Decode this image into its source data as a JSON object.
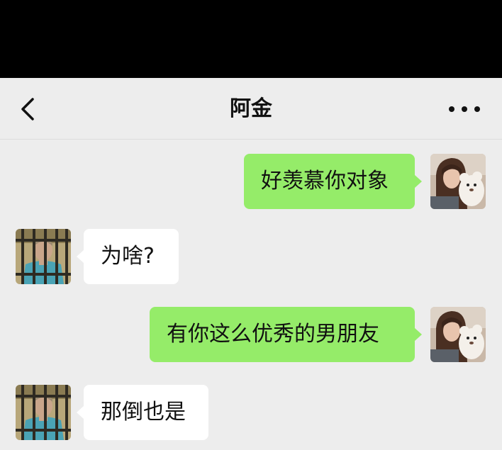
{
  "header": {
    "title": "阿金",
    "back_icon": "chevron-left-icon",
    "more_icon": "more-dots-icon"
  },
  "messages": [
    {
      "side": "out",
      "text": "好羡慕你对象",
      "avatar": "girl-with-teddy-bear"
    },
    {
      "side": "in",
      "text": "为啥?",
      "avatar": "man-behind-bars"
    },
    {
      "side": "out",
      "text": "有你这么优秀的男朋友",
      "avatar": "girl-with-teddy-bear"
    },
    {
      "side": "in",
      "text": "那倒也是",
      "avatar": "man-behind-bars"
    }
  ],
  "colors": {
    "outgoing_bubble": "#95ec69",
    "incoming_bubble": "#ffffff",
    "background": "#ededed",
    "status_bar": "#000000"
  }
}
